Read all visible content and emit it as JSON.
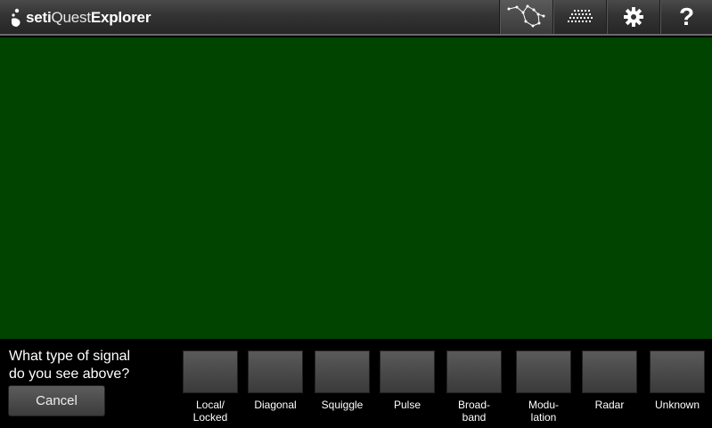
{
  "header": {
    "logo_seti": "seti",
    "logo_quest": "Quest",
    "logo_explorer": "Explorer",
    "icons": [
      "constellation-icon",
      "waterfall-icon",
      "gear-icon",
      "help-icon"
    ],
    "help_glyph": "?"
  },
  "question": {
    "line1": "What type of signal",
    "line2": "do you see above?"
  },
  "cancel_label": "Cancel",
  "signal_types": [
    {
      "line1": "Local/",
      "line2": "Locked"
    },
    {
      "line1": "Diagonal",
      "line2": ""
    },
    {
      "line1": "Squiggle",
      "line2": ""
    },
    {
      "line1": "Pulse",
      "line2": ""
    },
    {
      "line1": "Broad-",
      "line2": "band"
    },
    {
      "line1": "Modu-",
      "line2": "lation"
    },
    {
      "line1": "Radar",
      "line2": ""
    },
    {
      "line1": "Unknown",
      "line2": ""
    }
  ],
  "colors": {
    "signal_background": "#004400",
    "toolbar": "#333333"
  }
}
